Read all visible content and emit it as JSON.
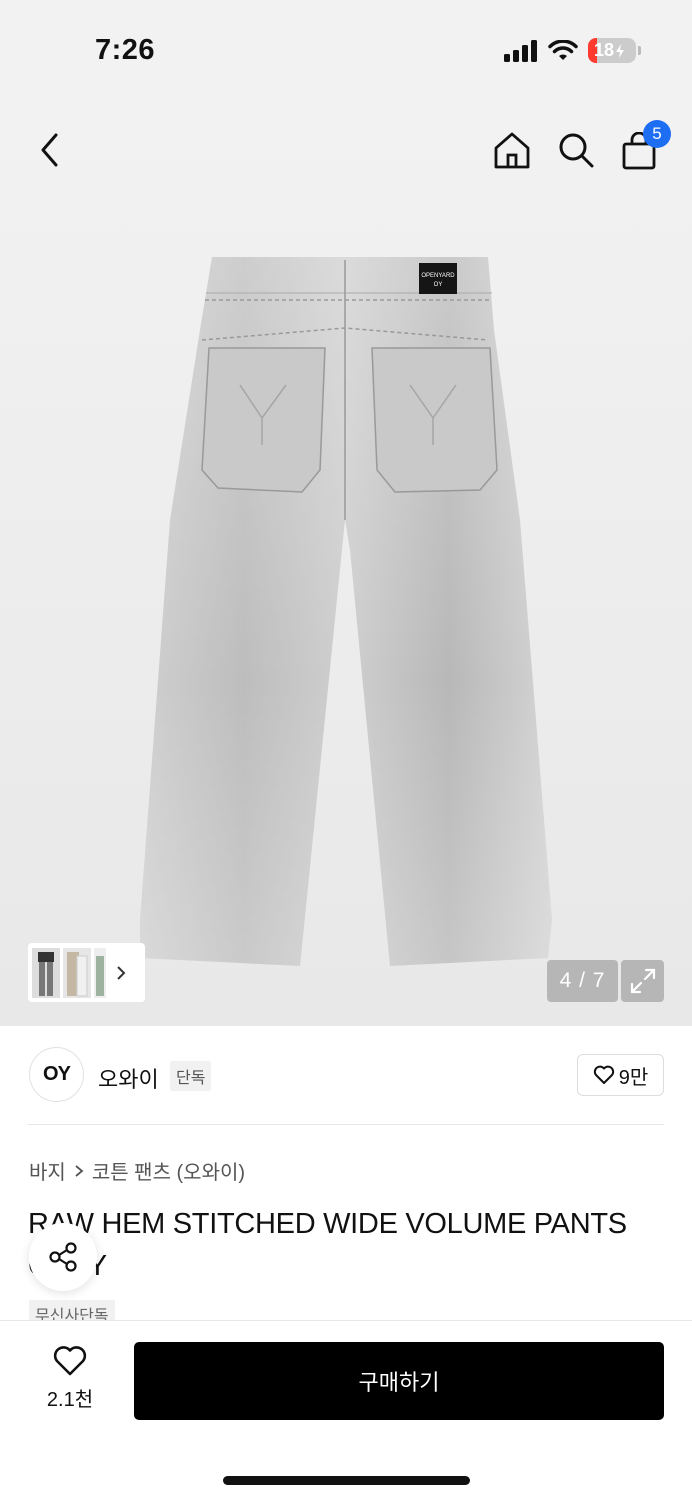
{
  "status": {
    "time": "7:26",
    "battery": "18",
    "battery_level": 0.18,
    "battery_color": "#ff3b30"
  },
  "nav": {
    "cart_count": "5",
    "badge_color": "#1e6ef4"
  },
  "gallery": {
    "index_label": "4 / 7",
    "current": 4,
    "total": 7
  },
  "brand": {
    "logo_text": "OY",
    "name": "오와이",
    "tag": "단독",
    "likes": "9만"
  },
  "breadcrumb": {
    "category": "바지",
    "subcategory": "코튼 팬츠 (오와이)"
  },
  "product": {
    "title": "RAW HEM STITCHED WIDE VOLUME PANTS GRAY",
    "exclusive_tag": "무신사단독"
  },
  "bottom": {
    "wish_count": "2.1천",
    "buy_label": "구매하기"
  },
  "icons": [
    "back-icon",
    "home-icon",
    "search-icon",
    "cart-icon",
    "chevron-right-icon",
    "expand-icon",
    "heart-icon",
    "share-icon",
    "signal-icon",
    "wifi-icon",
    "battery-icon"
  ]
}
